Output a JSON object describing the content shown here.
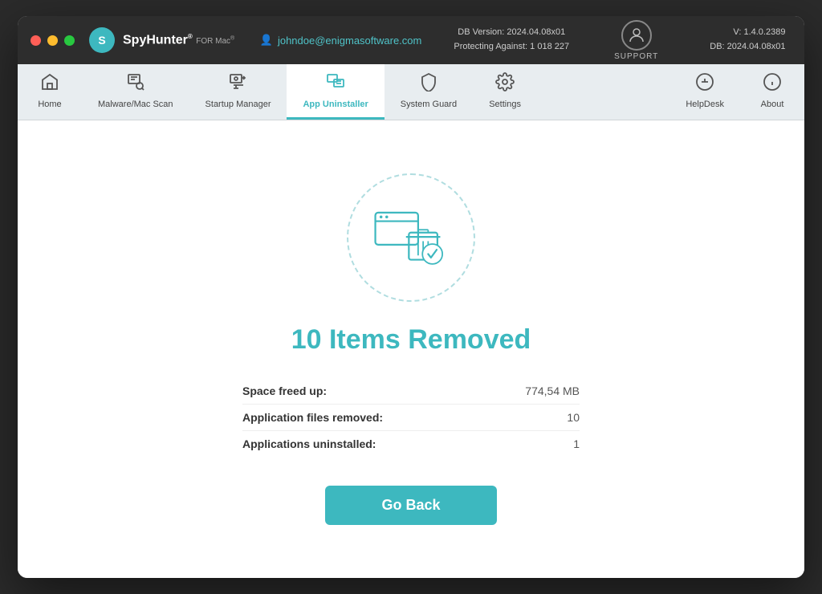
{
  "window": {
    "title": "SpyHunter for Mac"
  },
  "titlebar": {
    "logo": "SpyHunter",
    "logo_super": "®",
    "for_mac": "FOR Mac®",
    "user_email": "johndoe@enigmasoftware.com",
    "db_version_label": "DB Version:",
    "db_version": "2024.04.08x01",
    "protecting_label": "Protecting Against:",
    "protecting_count": "1 018 227",
    "support_label": "SUPPORT",
    "version": "V: 1.4.0.2389",
    "db_date": "DB:  2024.04.08x01"
  },
  "navbar": {
    "items": [
      {
        "id": "home",
        "label": "Home",
        "icon": "🏠",
        "active": false
      },
      {
        "id": "malware-scan",
        "label": "Malware/Mac Scan",
        "icon": "🔍",
        "active": false
      },
      {
        "id": "startup-manager",
        "label": "Startup Manager",
        "icon": "⚙",
        "active": false
      },
      {
        "id": "app-uninstaller",
        "label": "App Uninstaller",
        "icon": "🗂",
        "active": true
      },
      {
        "id": "system-guard",
        "label": "System Guard",
        "icon": "🛡",
        "active": false
      },
      {
        "id": "settings",
        "label": "Settings",
        "icon": "⚙",
        "active": false
      }
    ],
    "right_items": [
      {
        "id": "helpdesk",
        "label": "HelpDesk",
        "icon": "➕"
      },
      {
        "id": "about",
        "label": "About",
        "icon": "ℹ"
      }
    ]
  },
  "main": {
    "result_title": "10 Items Removed",
    "stats": [
      {
        "label": "Space freed up:",
        "value": "774,54 MB"
      },
      {
        "label": "Application files removed:",
        "value": "10"
      },
      {
        "label": "Applications uninstalled:",
        "value": "1"
      }
    ],
    "go_back_label": "Go Back"
  }
}
